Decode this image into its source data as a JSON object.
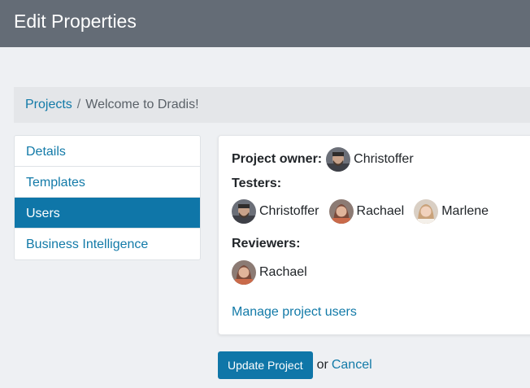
{
  "header": {
    "title": "Edit Properties"
  },
  "breadcrumb": {
    "items": [
      {
        "label": "Projects"
      },
      {
        "label": "Welcome to Dradis!"
      }
    ],
    "separator": "/"
  },
  "sidebar": {
    "items": [
      {
        "label": "Details",
        "active": false
      },
      {
        "label": "Templates",
        "active": false
      },
      {
        "label": "Users",
        "active": true
      },
      {
        "label": "Business Intelligence",
        "active": false
      }
    ]
  },
  "users_card": {
    "owner_label": "Project owner:",
    "owner": {
      "name": "Christoffer"
    },
    "testers_label": "Testers:",
    "testers": [
      {
        "name": "Christoffer"
      },
      {
        "name": "Rachael"
      },
      {
        "name": "Marlene"
      }
    ],
    "reviewers_label": "Reviewers:",
    "reviewers": [
      {
        "name": "Rachael"
      }
    ],
    "manage_link": "Manage project users"
  },
  "actions": {
    "submit_label": "Update Project",
    "or_text": "or",
    "cancel_label": "Cancel"
  },
  "colors": {
    "header_bg": "#646c76",
    "accent": "#0f76a8",
    "link": "#127aa8"
  }
}
